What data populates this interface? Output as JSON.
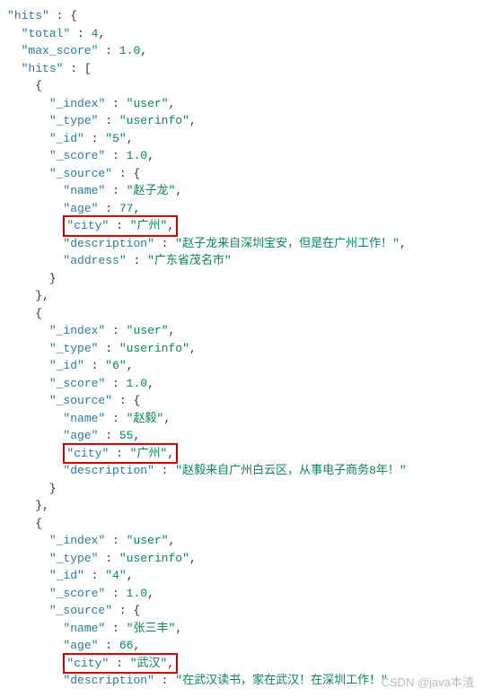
{
  "k": {
    "hits": "hits",
    "total": "total",
    "max_score": "max_score",
    "index": "_index",
    "type": "_type",
    "id": "_id",
    "score": "_score",
    "source": "_source",
    "name": "name",
    "age": "age",
    "city": "city",
    "description": "description",
    "address": "address"
  },
  "root": {
    "total": 4,
    "max_score": "1.0"
  },
  "records": [
    {
      "index": "user",
      "type": "userinfo",
      "id": "5",
      "score": "1.0",
      "name": "赵子龙",
      "age": 77,
      "city": "广州",
      "description": "赵子龙来自深圳宝安，但是在广州工作！",
      "address": "广东省茂名市"
    },
    {
      "index": "user",
      "type": "userinfo",
      "id": "6",
      "score": "1.0",
      "name": "赵毅",
      "age": 55,
      "city": "广州",
      "description": "赵毅来自广州白云区，从事电子商务8年！"
    },
    {
      "index": "user",
      "type": "userinfo",
      "id": "4",
      "score": "1.0",
      "name": "张三丰",
      "age": 66,
      "city": "武汉",
      "description": "在武汉读书，家在武汉！在深圳工作！"
    }
  ],
  "watermark": "CSDN @java本渣"
}
